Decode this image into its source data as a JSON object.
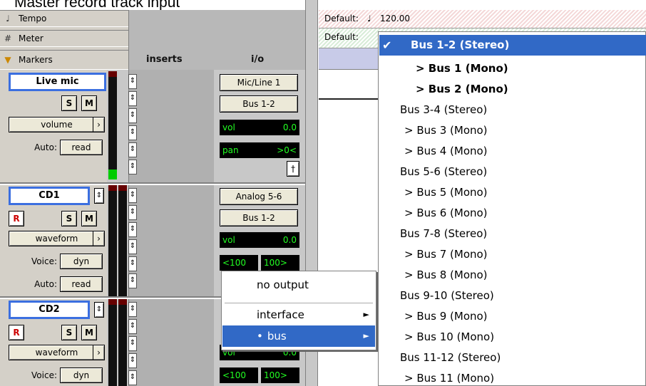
{
  "caption": "Master record track input",
  "rulers": [
    {
      "icon": "tempo-icon",
      "glyph": "♩",
      "label": "Tempo"
    },
    {
      "icon": "meter-icon",
      "glyph": "#",
      "label": "Meter"
    },
    {
      "icon": "markers-icon",
      "glyph": "▼",
      "label": "Markers"
    }
  ],
  "columns": {
    "inserts": "inserts",
    "io": "i/o"
  },
  "timeline": {
    "tempo_label": "Default:",
    "tempo_note": "♩",
    "tempo_value": "120.00",
    "meter_label": "Default:"
  },
  "tracks": [
    {
      "name": "Live mic",
      "solo": "S",
      "mute": "M",
      "view": "volume",
      "auto_label": "Auto:",
      "auto_value": "read",
      "input": "Mic/Line 1",
      "output": "Bus 1-2",
      "vol_label": "vol",
      "vol_value": "0.0",
      "pan_label": "pan",
      "pan_value": ">0<"
    },
    {
      "name": "CD1",
      "rec": "R",
      "solo": "S",
      "mute": "M",
      "view": "waveform",
      "voice_label": "Voice:",
      "voice_value": "dyn",
      "auto_label": "Auto:",
      "auto_value": "read",
      "input": "Analog 5-6",
      "output": "Bus 1-2",
      "vol_label": "vol",
      "vol_value": "0.0",
      "pan_left": "<100",
      "pan_right": "100>"
    },
    {
      "name": "CD2",
      "rec": "R",
      "solo": "S",
      "mute": "M",
      "view": "waveform",
      "voice_label": "Voice:",
      "voice_value": "dyn",
      "vol_label": "vol",
      "vol_value": "0.0",
      "pan_left": "<100",
      "pan_right": "100>"
    }
  ],
  "context_menu": {
    "no_output": "no output",
    "interface": "interface",
    "bus": "bus",
    "bus_bullet": "•",
    "arrow": "►"
  },
  "bus_menu": [
    {
      "label": "Bus 1-2 (Stereo)",
      "selected": true
    },
    {
      "label": "> Bus 1 (Mono)",
      "bold": true
    },
    {
      "label": "> Bus 2 (Mono)",
      "bold": true
    },
    {
      "label": "Bus 3-4 (Stereo)"
    },
    {
      "label": "> Bus 3 (Mono)"
    },
    {
      "label": "> Bus 4 (Mono)"
    },
    {
      "label": "Bus 5-6 (Stereo)"
    },
    {
      "label": "> Bus 5 (Mono)"
    },
    {
      "label": "> Bus 6 (Mono)"
    },
    {
      "label": "Bus 7-8 (Stereo)"
    },
    {
      "label": "> Bus 7 (Mono)"
    },
    {
      "label": "> Bus 8 (Mono)"
    },
    {
      "label": "Bus 9-10 (Stereo)"
    },
    {
      "label": "> Bus 9 (Mono)"
    },
    {
      "label": "> Bus 10 (Mono)"
    },
    {
      "label": "Bus 11-12 (Stereo)"
    },
    {
      "label": "> Bus 11 (Mono)"
    }
  ],
  "check_glyph": "✔",
  "colors": {
    "selection": "#3169c6",
    "name_border": "#3b6fe0",
    "meter_lit": "#00cc00",
    "lcd_text": "#22ff22"
  }
}
